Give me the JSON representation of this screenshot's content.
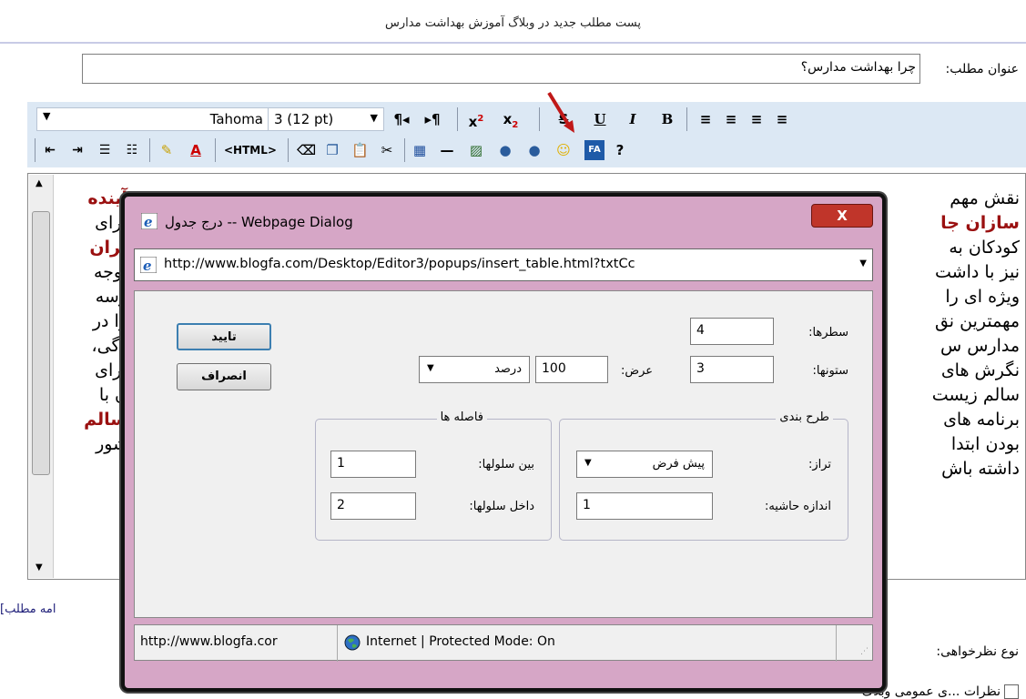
{
  "page": {
    "header_title": "پست مطلب جدید در وبلاگ آموزش بهداشت مدارس",
    "title_label": "عنوان مطلب:",
    "title_value": "چرا بهداشت مدارس؟",
    "more_link": "امه مطلب]",
    "comment_type_label": "نوع نظرخواهی:",
    "bottom_checkbox_text": "نظرات ...ی عمومی وبلاگ"
  },
  "toolbar": {
    "font_name": "Tahoma",
    "font_size": "3 (12 pt)",
    "row1_buttons": [
      "¶◂",
      "▸¶",
      "x²",
      "x₂",
      "S",
      "U",
      "I",
      "B",
      "align-right",
      "align-center",
      "align-left",
      "justify"
    ],
    "html_label": "<HTML>",
    "fa_label": "FA",
    "help_label": "?"
  },
  "editor": {
    "lines_right": [
      "نقش مهم",
      "سازان جا",
      "کودکان به",
      "نیز با داشت",
      "ویژه ای را",
      "مهمترین نق",
      "مدارس س",
      "نگرش های",
      "سالم زیست",
      "برنامه های",
      "بودن ابتدا",
      "داشته باش"
    ],
    "lines_left": [
      "آینده",
      "برای",
      "یران",
      "توجه",
      "رسه",
      "را در",
      "دگی،",
      "برای",
      "ن با",
      "سالم",
      "شور",
      ""
    ]
  },
  "dialog": {
    "title": "درج جدول -- Webpage Dialog",
    "close_label": "X",
    "url": "http://www.blogfa.com/Desktop/Editor3/popups/insert_table.html?txtCc",
    "ok_label": "تایید",
    "cancel_label": "انصراف",
    "rows_label": "سطرها:",
    "rows_value": "4",
    "cols_label": "ستونها:",
    "cols_value": "3",
    "width_label": "عرض:",
    "width_value": "100",
    "width_unit": "درصد",
    "layout_legend": "طرح بندی",
    "align_label": "تراز:",
    "align_value": "پیش فرض",
    "border_label": "اندازه حاشیه:",
    "border_value": "1",
    "spacing_legend": "فاصله ها",
    "cell_spacing_label": "بین سلولها:",
    "cell_spacing_value": "1",
    "cell_padding_label": "داخل سلولها:",
    "cell_padding_value": "2",
    "status_url": "http://www.blogfa.cor",
    "status_zone": "Internet | Protected Mode: On"
  },
  "colors": {
    "toolbar_bg": "#dce8f4",
    "dialog_frame": "#d6a6c6",
    "highlight_text": "#9a1010",
    "close_button": "#c0352a"
  }
}
